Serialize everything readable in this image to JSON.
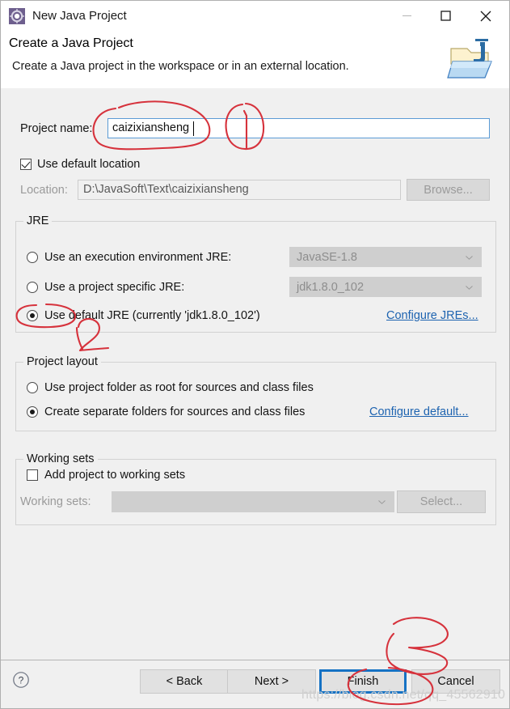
{
  "window": {
    "title": "New Java Project",
    "icon": "java-project-gear-icon",
    "controls": {
      "minimize": "minimize-icon",
      "maximize": "maximize-icon",
      "close": "close-icon"
    }
  },
  "header": {
    "title": "Create a Java Project",
    "subtitle": "Create a Java project in the workspace or in an external location.",
    "banner_icon": "java-folder-icon"
  },
  "form": {
    "project_name_label": "Project name:",
    "project_name_value": "caizixiansheng",
    "use_default_location_label": "Use default location",
    "use_default_location_checked": true,
    "location_label": "Location:",
    "location_value": "D:\\JavaSoft\\Text\\caizixiansheng",
    "browse_label": "Browse..."
  },
  "jre": {
    "group_title": "JRE",
    "options": [
      {
        "label": "Use an execution environment JRE:",
        "selected": false,
        "combo_value": "JavaSE-1.8"
      },
      {
        "label": "Use a project specific JRE:",
        "selected": false,
        "combo_value": "jdk1.8.0_102"
      },
      {
        "label": "Use default JRE (currently 'jdk1.8.0_102')",
        "selected": true,
        "combo_value": ""
      }
    ],
    "configure_link": "Configure JREs..."
  },
  "project_layout": {
    "group_title": "Project layout",
    "options": [
      {
        "label": "Use project folder as root for sources and class files",
        "selected": false
      },
      {
        "label": "Create separate folders for sources and class files",
        "selected": true
      }
    ],
    "configure_link": "Configure default..."
  },
  "working_sets": {
    "group_title": "Working sets",
    "add_label": "Add project to working sets",
    "add_checked": false,
    "sets_label": "Working sets:",
    "sets_value": "",
    "select_label": "Select..."
  },
  "footer": {
    "help_icon": "help-question-icon",
    "back_label": "< Back",
    "next_label": "Next >",
    "finish_label": "Finish",
    "cancel_label": "Cancel"
  },
  "annotations": {
    "color": "#d6323c",
    "marks": [
      {
        "name": "circle-around-project-name",
        "text": ""
      },
      {
        "name": "handwritten-one",
        "text": "1"
      },
      {
        "name": "circle-around-default-jre-radio",
        "text": ""
      },
      {
        "name": "handwritten-two",
        "text": "2"
      },
      {
        "name": "handwritten-three",
        "text": "3"
      },
      {
        "name": "circle-around-finish",
        "text": ""
      }
    ]
  },
  "watermark": {
    "text": "https://blog.csdn.net/qq_45562910"
  }
}
